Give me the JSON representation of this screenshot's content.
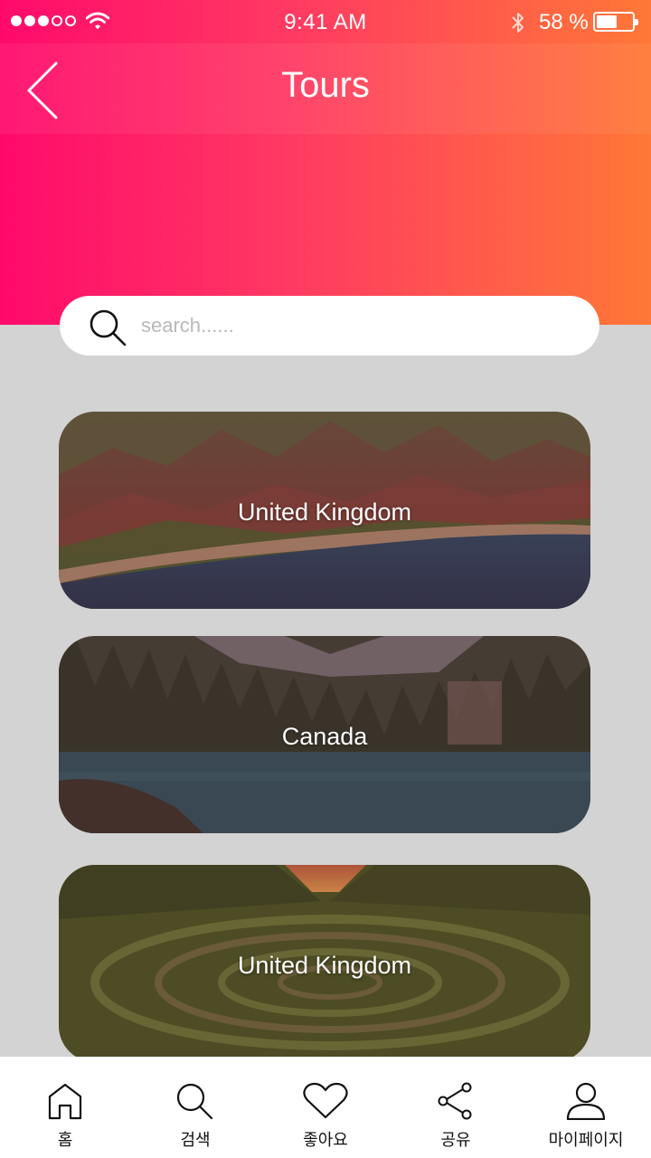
{
  "status_bar": {
    "time": "9:41 AM",
    "battery_percent": "58 %",
    "signal_bars_filled": 3,
    "signal_bars_total": 5,
    "battery_level": 0.58
  },
  "header": {
    "title": "Tours",
    "back_icon": "chevron-left-icon"
  },
  "search": {
    "placeholder": "search......",
    "value": "",
    "icon": "search-icon"
  },
  "tours": [
    {
      "label": "United Kingdom",
      "scene": "coastal cliffs"
    },
    {
      "label": "Canada",
      "scene": "forest lake"
    },
    {
      "label": "United Kingdom",
      "scene": "grass spiral at sunset"
    }
  ],
  "tab_bar": {
    "items": [
      {
        "label": "홈",
        "icon": "home-icon"
      },
      {
        "label": "검색",
        "icon": "search-icon"
      },
      {
        "label": "좋아요",
        "icon": "heart-icon"
      },
      {
        "label": "공유",
        "icon": "share-icon"
      },
      {
        "label": "마이페이지",
        "icon": "person-icon"
      }
    ]
  },
  "colors": {
    "gradient_start": "#ff0a6c",
    "gradient_end": "#ff7836",
    "background": "#d3d3d3"
  }
}
